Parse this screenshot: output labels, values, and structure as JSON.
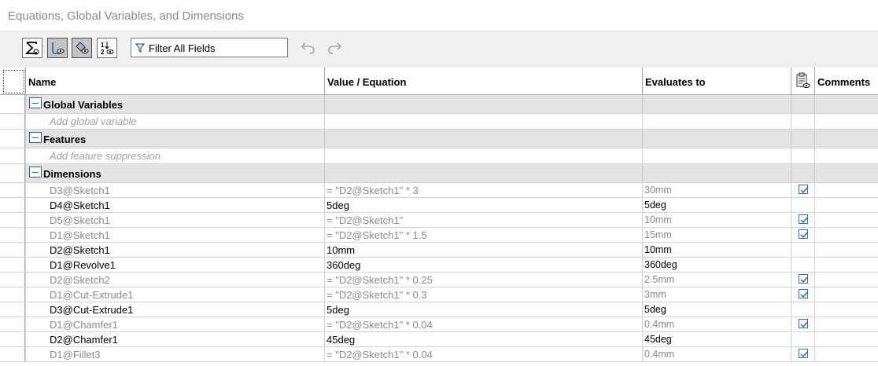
{
  "window": {
    "title": "Equations, Global Variables, and Dimensions"
  },
  "toolbar": {
    "buttons": [
      {
        "name": "equation-view-button",
        "icon": "sigma-icon",
        "active": false
      },
      {
        "name": "sketch-equation-view-button",
        "icon": "sketch-view-icon",
        "active": true
      },
      {
        "name": "dimension-view-button",
        "icon": "dimension-view-icon",
        "active": true
      },
      {
        "name": "ordered-view-button",
        "icon": "ordered-view-icon",
        "active": false
      }
    ],
    "filter_text": "Filter All Fields"
  },
  "grid": {
    "columns": [
      "Name",
      "Value / Equation",
      "Evaluates to",
      "",
      "Comments"
    ],
    "rows": [
      {
        "type": "group",
        "name": "Global Variables"
      },
      {
        "type": "add",
        "name": "Add global variable"
      },
      {
        "type": "group",
        "name": "Features"
      },
      {
        "type": "add",
        "name": "Add feature suppression"
      },
      {
        "type": "group",
        "name": "Dimensions"
      },
      {
        "type": "dim",
        "name": "D3@Sketch1",
        "value": "= \"D2@Sketch1\" * 3",
        "eval": "30mm",
        "checked": true,
        "driven": true
      },
      {
        "type": "dim",
        "name": "D4@Sketch1",
        "value": "5deg",
        "eval": "5deg",
        "checked": false,
        "driven": false
      },
      {
        "type": "dim",
        "name": "D5@Sketch1",
        "value": "= \"D2@Sketch1\"",
        "eval": "10mm",
        "checked": true,
        "driven": true
      },
      {
        "type": "dim",
        "name": "D1@Sketch1",
        "value": "= \"D2@Sketch1\" * 1.5",
        "eval": "15mm",
        "checked": true,
        "driven": true
      },
      {
        "type": "dim",
        "name": "D2@Sketch1",
        "value": "10mm",
        "eval": "10mm",
        "checked": false,
        "driven": false
      },
      {
        "type": "dim",
        "name": "D1@Revolve1",
        "value": "360deg",
        "eval": "360deg",
        "checked": false,
        "driven": false
      },
      {
        "type": "dim",
        "name": "D2@Sketch2",
        "value": "= \"D2@Sketch1\" * 0.25",
        "eval": "2.5mm",
        "checked": true,
        "driven": true
      },
      {
        "type": "dim",
        "name": "D1@Cut-Extrude1",
        "value": "= \"D2@Sketch1\" * 0.3",
        "eval": "3mm",
        "checked": true,
        "driven": true
      },
      {
        "type": "dim",
        "name": "D3@Cut-Extrude1",
        "value": "5deg",
        "eval": "5deg",
        "checked": false,
        "driven": false
      },
      {
        "type": "dim",
        "name": "D1@Chamfer1",
        "value": "= \"D2@Sketch1\" * 0.04",
        "eval": "0.4mm",
        "checked": true,
        "driven": true
      },
      {
        "type": "dim",
        "name": "D2@Chamfer1",
        "value": "45deg",
        "eval": "45deg",
        "checked": false,
        "driven": false
      },
      {
        "type": "dim",
        "name": "D1@Fillet3",
        "value": "= \"D2@Sketch1\" * 0.04",
        "eval": "0.4mm",
        "checked": true,
        "driven": true
      }
    ]
  },
  "colors": {
    "group_bg": "#e4e4e4",
    "driven_text": "#8a8a8a",
    "checkbox": "#2f6db3"
  }
}
